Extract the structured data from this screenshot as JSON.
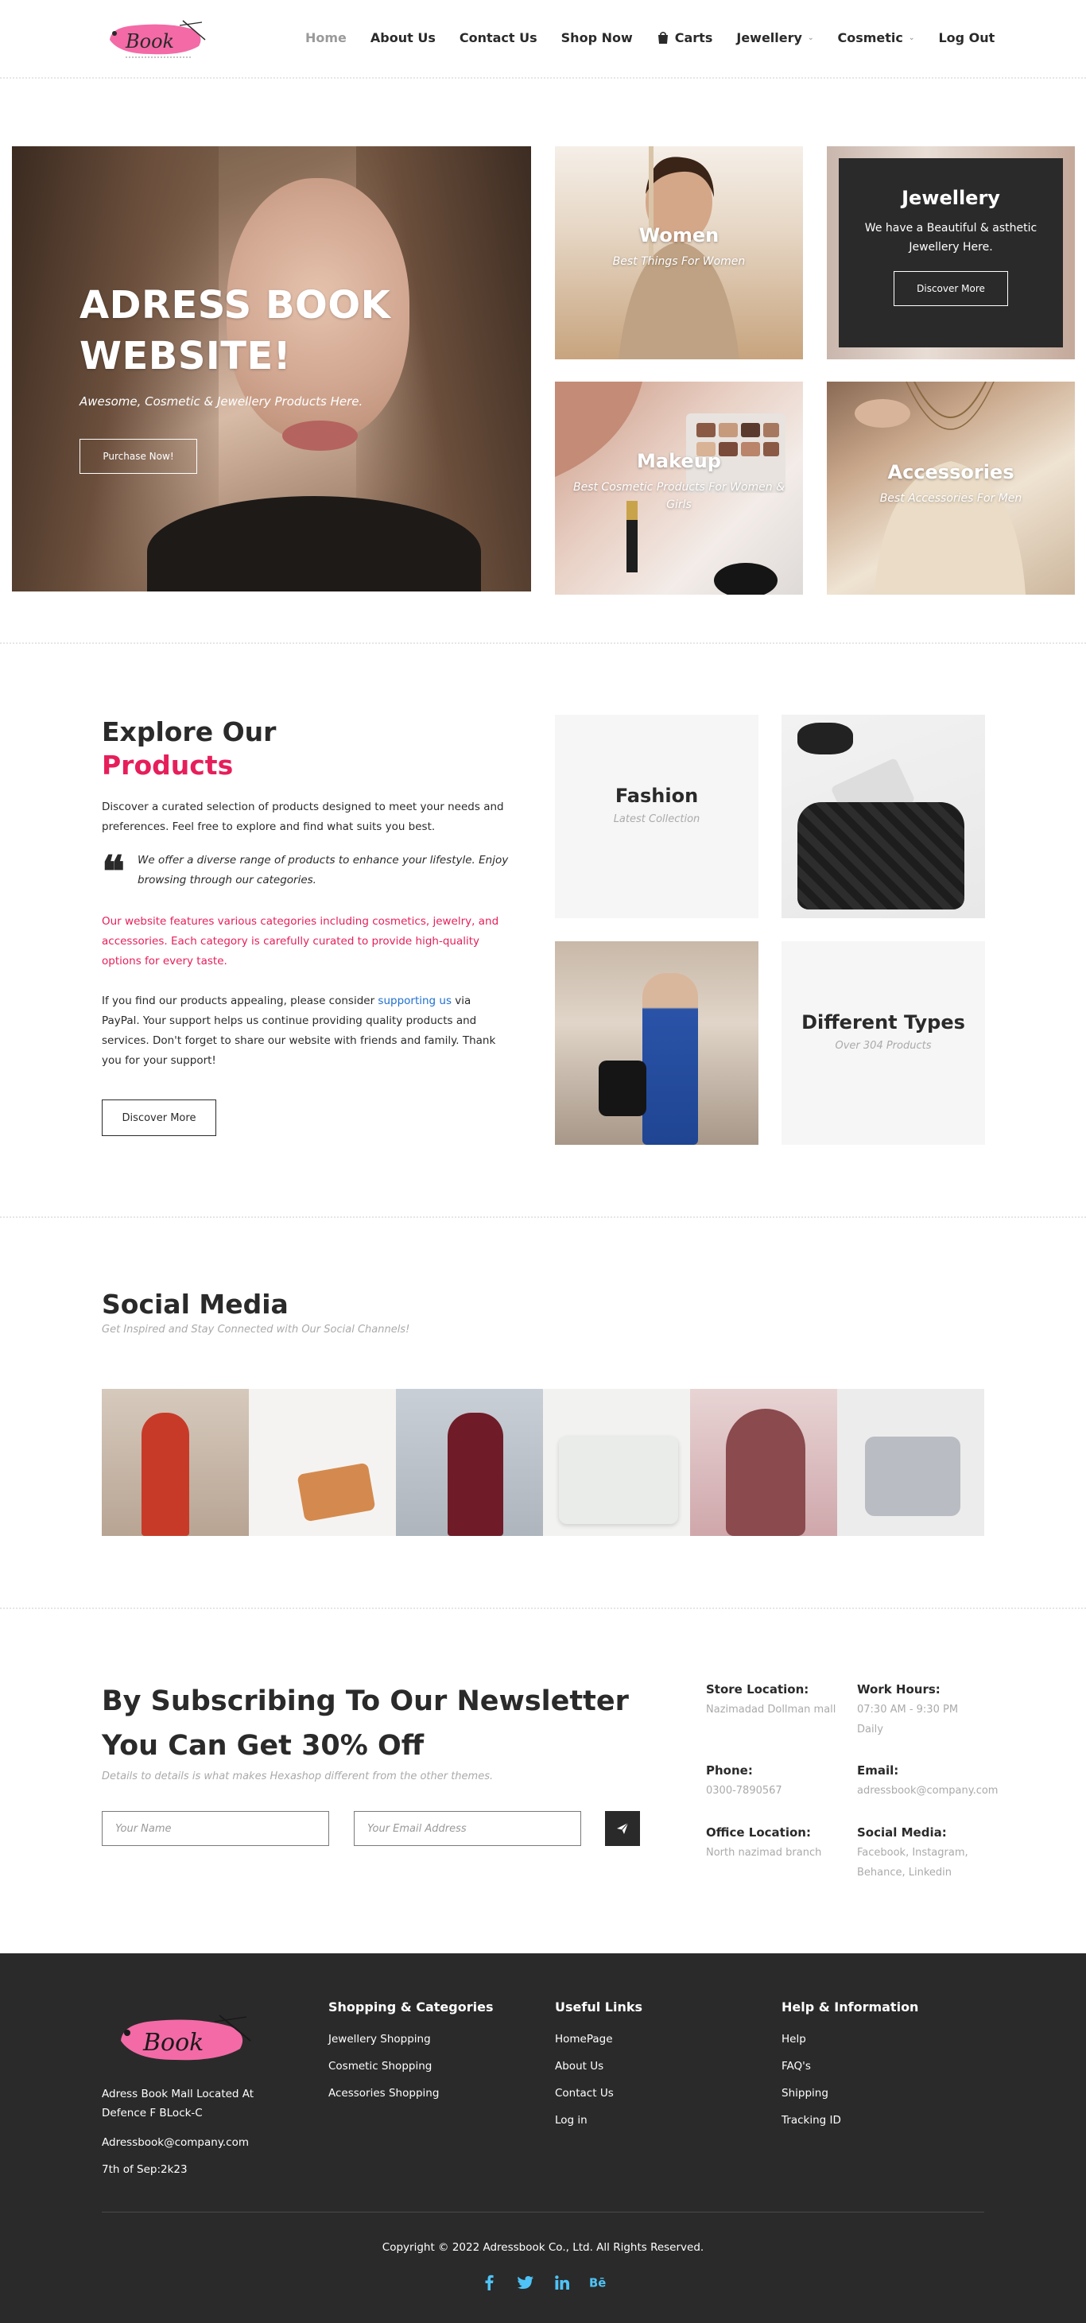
{
  "header": {
    "logo_text": "Book",
    "nav": [
      {
        "label": "Home"
      },
      {
        "label": "About Us"
      },
      {
        "label": "Contact Us"
      },
      {
        "label": "Shop Now"
      },
      {
        "label": "Carts",
        "icon": "shopping-bag-icon"
      },
      {
        "label": "Jewellery",
        "dropdown": true
      },
      {
        "label": "Cosmetic",
        "dropdown": true
      },
      {
        "label": "Log Out"
      }
    ]
  },
  "hero": {
    "title": "ADRESS BOOK WEBSITE!",
    "subtitle": "Awesome, Cosmetic & Jewellery Products Here.",
    "button": "Purchase Now!",
    "tiles": {
      "women": {
        "title": "Women",
        "text": "Best Things For Women"
      },
      "jewellery": {
        "title": "Jewellery",
        "text": "We have a Beautiful & asthetic Jewellery Here.",
        "button": "Discover More"
      },
      "makeup": {
        "title": "Makeup",
        "text": "Best Cosmetic Products For Women & Girls"
      },
      "accessories": {
        "title": "Accessories",
        "text": "Best Accessories For Men"
      }
    }
  },
  "explore": {
    "title_line1": "Explore Our",
    "title_line2": "Products",
    "intro": "Discover a curated selection of products designed to meet your needs and preferences. Feel free to explore and find what suits you best.",
    "quote": "We offer a diverse range of products to enhance your lifestyle. Enjoy browsing through our categories.",
    "highlight": "Our website features various categories including cosmetics, jewelry, and accessories. Each category is carefully curated to provide high-quality options for every taste.",
    "support_before": "If you find our products appealing, please consider ",
    "support_link": "supporting us",
    "support_after": " via PayPal. Your support helps us continue providing quality products and services. Don't forget to share our website with friends and family. Thank you for your support!",
    "button": "Discover More",
    "tiles": {
      "fashion": {
        "title": "Fashion",
        "text": "Latest Collection"
      },
      "types": {
        "title": "Different Types",
        "text": "Over 304 Products"
      }
    }
  },
  "social": {
    "title": "Social Media",
    "subtitle": "Get Inspired and Stay Connected with Our Social Channels!"
  },
  "newsletter": {
    "title": "By Subscribing To Our Newsletter You Can Get 30% Off",
    "subtitle": "Details to details is what makes Hexashop different from the other themes.",
    "name_placeholder": "Your Name",
    "email_placeholder": "Your Email Address",
    "info": {
      "store": {
        "label": "Store Location:",
        "value": "Nazimadad Dollman mall"
      },
      "hours": {
        "label": "Work Hours:",
        "value": "07:30 AM - 9:30 PM Daily"
      },
      "phone": {
        "label": "Phone:",
        "value": "0300-7890567"
      },
      "email": {
        "label": "Email:",
        "value": "adressbook@company.com"
      },
      "office": {
        "label": "Office Location:",
        "value": "North nazimad branch"
      },
      "social": {
        "label": "Social Media:",
        "value": "Facebook, Instagram, Behance, Linkedin"
      }
    }
  },
  "footer": {
    "logo_text": "Book",
    "address": "Adress Book Mall Located At Defence F BLock-C",
    "email": "Adressbook@company.com",
    "date": "7th of Sep:2k23",
    "columns": {
      "shopping": {
        "title": "Shopping & Categories",
        "links": [
          "Jewellery Shopping",
          "Cosmetic Shopping",
          "Acessories Shopping"
        ]
      },
      "useful": {
        "title": "Useful Links",
        "links": [
          "HomePage",
          "About Us",
          "Contact Us",
          "Log in"
        ]
      },
      "help": {
        "title": "Help & Information",
        "links": [
          "Help",
          "FAQ's",
          "Shipping",
          "Tracking ID"
        ]
      }
    },
    "copyright": "Copyright © 2022 Adressbook Co., Ltd. All Rights Reserved.",
    "socials": [
      "facebook-icon",
      "twitter-icon",
      "linkedin-icon",
      "behance-icon"
    ]
  },
  "colors": {
    "accent_pink": "#e61e5a",
    "dark": "#2a2a2a",
    "muted": "#aaaaaa",
    "link_blue": "#1f6fd1"
  }
}
